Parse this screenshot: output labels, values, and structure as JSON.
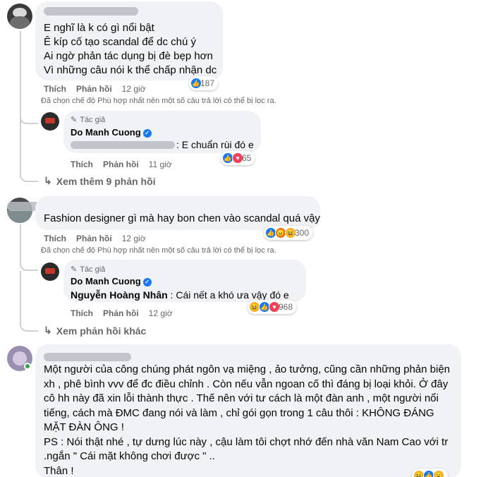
{
  "comment1": {
    "lines": [
      "E nghĩ là k có gì nổi bật",
      "Ê kíp cố tạo scandal để dc chú ý",
      "Ai ngờ phản tác dụng bị đè bẹp hơn",
      "Vì những câu nói k thể chấp nhận dc"
    ],
    "reaction_count": "187",
    "like": "Thích",
    "reply": "Phản hồi",
    "time": "12 giờ",
    "notice": "Đã chọn chế độ Phù hợp nhất nên một số câu trả lời có thể bị lọc ra.",
    "reply1": {
      "author_tag": "Tác giả",
      "author": "Do Manh Cuong",
      "text": ": E chuẩn rùi đó e",
      "reaction_count": "65",
      "like": "Thích",
      "reply": "Phản hồi",
      "time": "11 giờ"
    },
    "more": "Xem thêm 9 phản hồi"
  },
  "comment2": {
    "text": "Fashion designer gì mà hay bon chen vào scandal quá vậy",
    "reaction_count": "300",
    "like": "Thích",
    "reply": "Phản hồi",
    "time": "12 giờ",
    "notice": "Đã chọn chế độ Phù hợp nhất nên một số câu trả lời có thể bị lọc ra.",
    "reply1": {
      "author_tag": "Tác giả",
      "author": "Do Manh Cuong",
      "mention": "Nguyễn Hoàng Nhân",
      "text": " : Cái nết a khó ưa vậy đó e",
      "reaction_count": "968",
      "like": "Thích",
      "reply": "Phản hồi",
      "time": "12 giờ"
    },
    "more": "Xem phản hồi khác"
  },
  "comment3": {
    "lines": [
      "Một người của công chúng phát ngôn vạ miệng , ảo tưởng, cũng cần những phản biện",
      "xh , phê bình vvv để đc điều chỉnh . Còn nếu vẫn ngoan cố thì đáng bị loại khỏi. Ở đây",
      "cô hh này đã xin lỗi thành thực . Thế nên với tư cách là một đàn anh , một người nổi",
      "tiếng, cách mà ĐMC đang nói và làm , chỉ gói gọn trong 1 câu thôi : KHÔNG ĐÁNG",
      "MẶT ĐÀN ÔNG !",
      "PS : Nói thật nhé , tự dưng lúc này , cậu làm tôi chợt nhớ đến nhà văn Nam Cao với tr",
      ".ngắn \" Cái mặt không chơi được \" ..",
      "Thân !"
    ]
  },
  "colors": {
    "bubble": "#f0f2f5",
    "meta": "#65676b",
    "like": "#1877f2",
    "love": "#f33e58",
    "haha": "#f7b125",
    "angry": "#e9710f"
  }
}
